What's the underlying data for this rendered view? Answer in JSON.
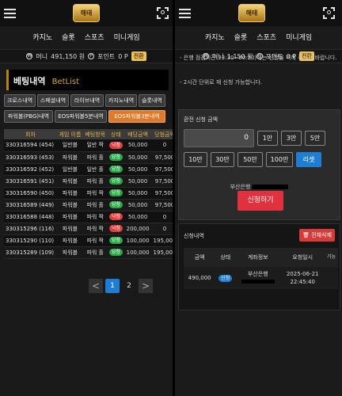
{
  "nav": [
    "카지노",
    "슬롯",
    "스포츠",
    "미니게임"
  ],
  "logo_text": "해태",
  "left": {
    "wallet": {
      "money_label": "머니",
      "money": "491,150 원",
      "point_label": "포인트",
      "point": "0 P",
      "exchange": "전환"
    },
    "title": {
      "ko": "베팅내역",
      "en": "BetList"
    },
    "filters": [
      "크로스내역",
      "스페셜내역",
      "라이브내역",
      "카지노내역",
      "슬롯내역",
      "파워볼(PBG)내역",
      "EOS파워볼5분내역",
      "EOS파워볼3분내역"
    ],
    "table": {
      "headers": [
        "회차",
        "게임 이름",
        "베팅항목",
        "상태",
        "배당금액",
        "당첨금액"
      ],
      "rows": [
        {
          "round": "330316594 (454)",
          "game": "일반볼",
          "item": "일반 짝",
          "status": "낙첨",
          "bet": "50,000",
          "win": "0"
        },
        {
          "round": "330316593 (453)",
          "game": "파워볼",
          "item": "파워 홀",
          "status": "당첨",
          "bet": "50,000",
          "win": "97,500"
        },
        {
          "round": "330316592 (452)",
          "game": "일반볼",
          "item": "일반 홀",
          "status": "당첨",
          "bet": "50,000",
          "win": "97,500"
        },
        {
          "round": "330316591 (451)",
          "game": "파워볼",
          "item": "파워 홀",
          "status": "당첨",
          "bet": "50,000",
          "win": "97,500"
        },
        {
          "round": "330316590 (450)",
          "game": "파워볼",
          "item": "파워 짝",
          "status": "당첨",
          "bet": "50,000",
          "win": "97,500"
        },
        {
          "round": "330316589 (449)",
          "game": "파워볼",
          "item": "파워 홀",
          "status": "당첨",
          "bet": "50,000",
          "win": "97,500"
        },
        {
          "round": "330316588 (448)",
          "game": "파워볼",
          "item": "파워 짝",
          "status": "낙첨",
          "bet": "50,000",
          "win": "0"
        },
        {
          "round": "330315296 (116)",
          "game": "파워볼",
          "item": "파워 짝",
          "status": "낙첨",
          "bet": "200,000",
          "win": "0"
        },
        {
          "round": "330315290 (110)",
          "game": "파워볼",
          "item": "파워 짝",
          "status": "당첨",
          "bet": "100,000",
          "win": "195,000"
        },
        {
          "round": "330315289 (109)",
          "game": "파워볼",
          "item": "파워 홀",
          "status": "당첨",
          "bet": "100,000",
          "win": "195,000"
        }
      ]
    },
    "pagination": {
      "prev": "<",
      "pages": [
        "1",
        "2"
      ],
      "next": ">"
    }
  },
  "right": {
    "wallet": {
      "money_label": "머니",
      "money": "1,150 원",
      "point_label": "포인트",
      "point": "0 P",
      "exchange": "전환"
    },
    "notice_lines": [
      "- 은행 점검시간(23:30~00:30)에는 신청을 피해 주시기 바랍니다.",
      "- 2시간 단위로 재 신청 가능합니다."
    ],
    "exchange": {
      "label": "환전 신청 금액",
      "amount": "0",
      "buttons_row1": [
        "1만",
        "3만",
        "5만"
      ],
      "buttons_row2": [
        "10만",
        "30만",
        "50만",
        "100만",
        "리셋"
      ],
      "bank": "부산은행",
      "submit": "신청하기"
    },
    "history": {
      "label": "신청내역",
      "delete_all": "전체삭제",
      "headers": [
        "금액",
        "상태",
        "계좌정보",
        "요청일시",
        "기능"
      ],
      "row": {
        "amount": "490,000",
        "status": "신청",
        "bank": "부산은행",
        "date": "2025-06-21",
        "time": "22:45:40"
      }
    }
  }
}
